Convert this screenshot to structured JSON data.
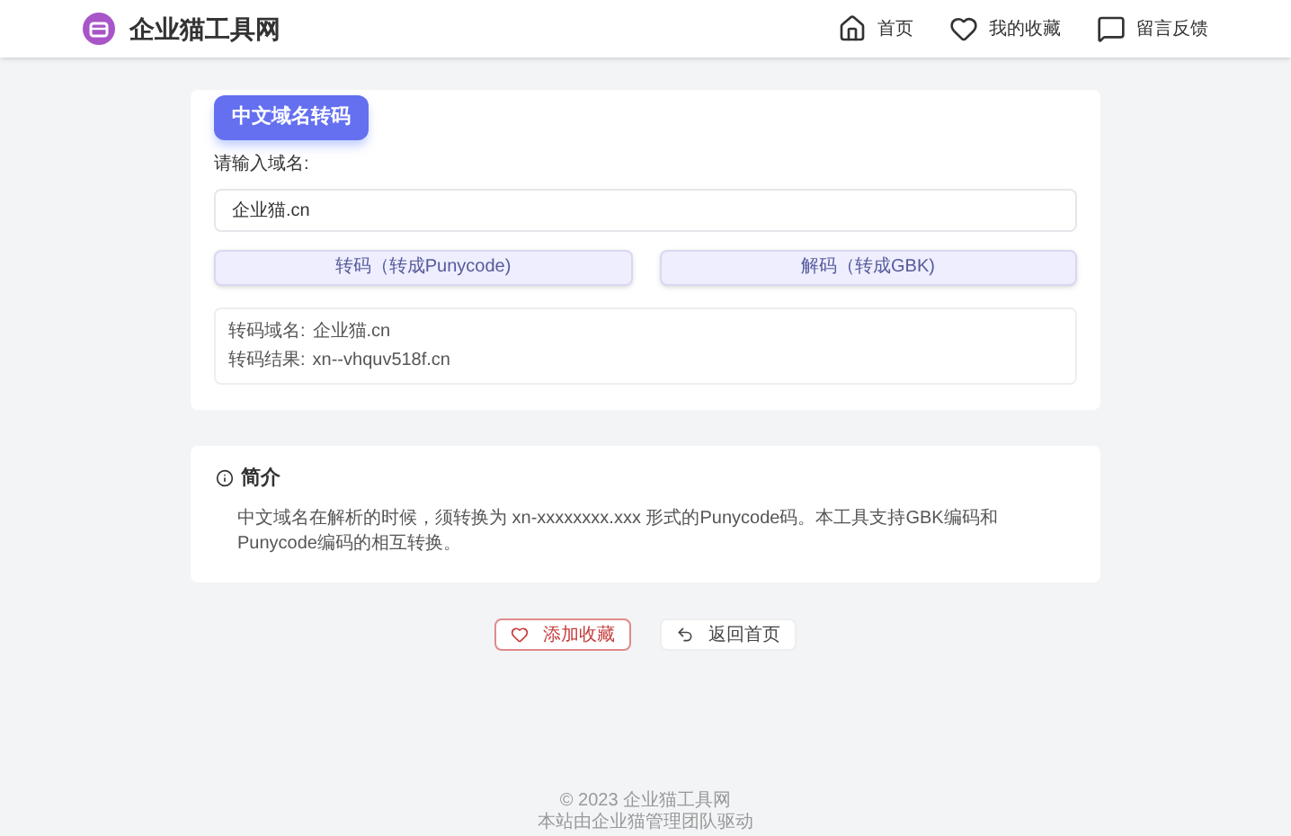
{
  "header": {
    "logo": "企业猫工具网",
    "nav": [
      {
        "label": "首页"
      },
      {
        "label": "我的收藏"
      },
      {
        "label": "留言反馈"
      }
    ]
  },
  "tool": {
    "badge": "中文域名转码",
    "label": "请输入域名:",
    "value": "企业猫.cn",
    "buttons": [
      "转码（转成Punycode)",
      "解码（转成GBK)"
    ],
    "result": [
      {
        "label": "转码域名:",
        "value": "企业猫.cn"
      },
      {
        "label": "转码结果:",
        "value": "xn--vhquv518f.cn"
      }
    ]
  },
  "intro": {
    "title": "简介",
    "text": "中文域名在解析的时候，须转换为 xn-xxxxxxxx.xxx 形式的Punycode码。本工具支持GBK编码和Punycode编码的相互转换。"
  },
  "actions": [
    {
      "label": "添加收藏",
      "kind": "primary"
    },
    {
      "label": "返回首页",
      "kind": "plain"
    }
  ],
  "footer": [
    "© 2023 企业猫工具网",
    "本站由企业猫管理团队驱动"
  ]
}
